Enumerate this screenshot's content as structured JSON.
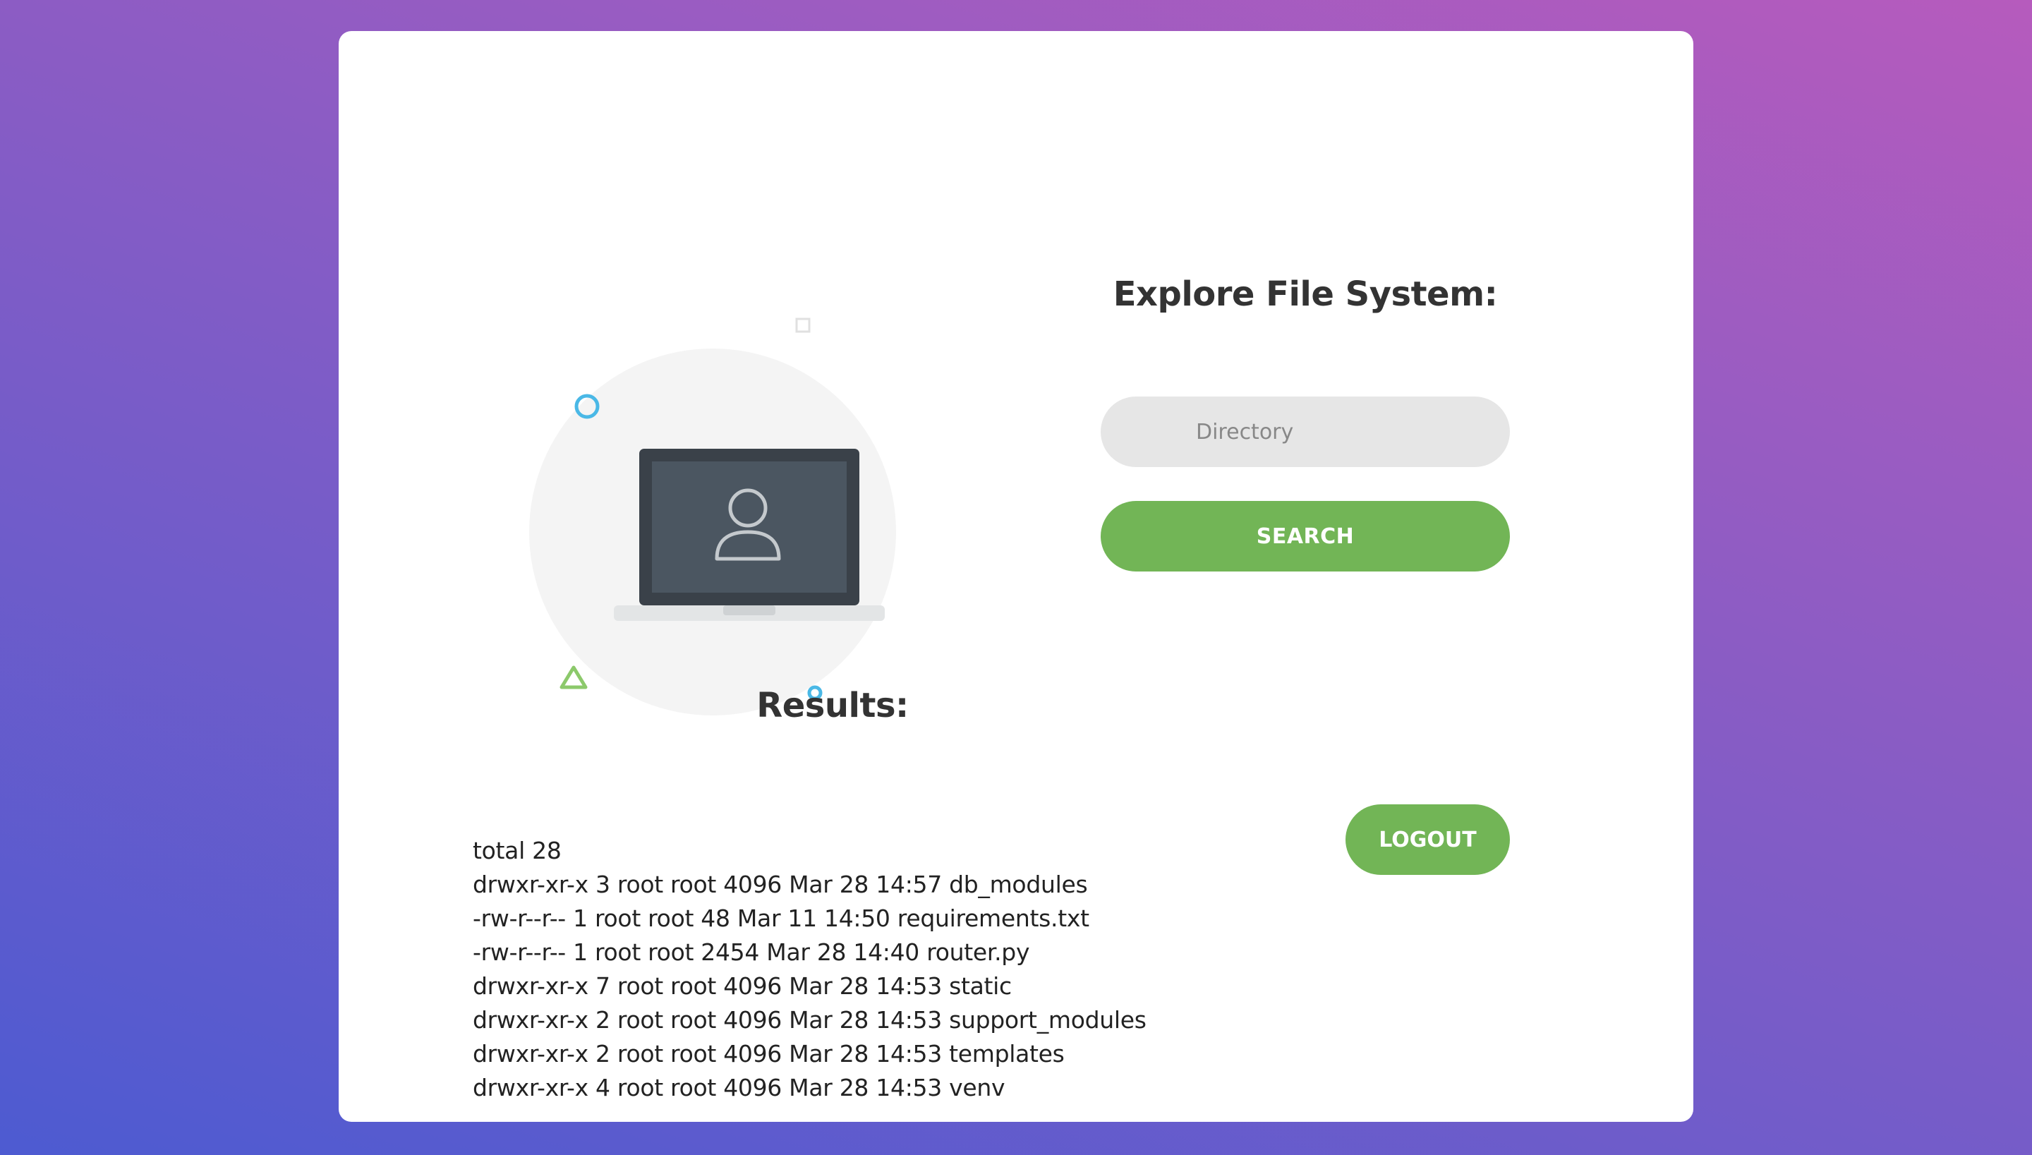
{
  "form": {
    "title": "Explore File System:",
    "directory_placeholder": "Directory",
    "directory_value": "",
    "search_label": "SEARCH"
  },
  "results": {
    "title": "Results:",
    "lines": [
      "total 28",
      "drwxr-xr-x 3 root root 4096 Mar 28 14:57 db_modules",
      "-rw-r--r-- 1 root root 48 Mar 11 14:50 requirements.txt",
      "-rw-r--r-- 1 root root 2454 Mar 28 14:40 router.py",
      "drwxr-xr-x 7 root root 4096 Mar 28 14:53 static",
      "drwxr-xr-x 2 root root 4096 Mar 28 14:53 support_modules",
      "drwxr-xr-x 2 root root 4096 Mar 28 14:53 templates",
      "drwxr-xr-x 4 root root 4096 Mar 28 14:53 venv"
    ]
  },
  "logout_label": "LOGOUT",
  "illustration": {
    "icons": [
      "laptop-icon",
      "user-icon",
      "circle-decoration",
      "triangle-decoration",
      "square-decoration"
    ]
  },
  "colors": {
    "accent_green": "#72b556",
    "decor_blue": "#4ab8e6",
    "decor_green": "#8cc96b",
    "input_bg": "#e6e6e6",
    "heading_text": "#333333"
  }
}
